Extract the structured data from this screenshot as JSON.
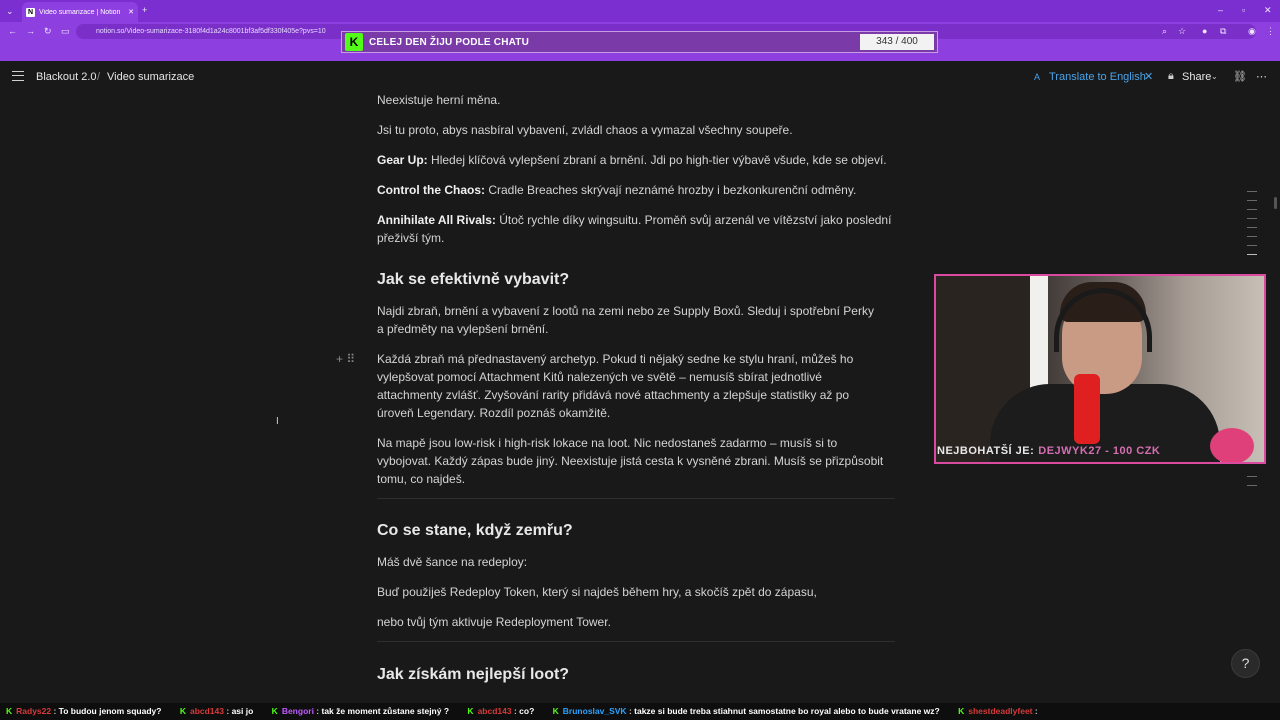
{
  "browser": {
    "tab_title": "Video sumarizace | Notion",
    "url": "notion.so/Video-sumarizace-3180f4d1a24c8001bf3af5df330f405e?pvs=10"
  },
  "goal_overlay": {
    "text": "CELEJ DEN ŽIJU PODLE CHATU",
    "count": "343 / 400"
  },
  "notion": {
    "breadcrumb": [
      "Blackout 2.0",
      "Video sumarizace"
    ],
    "translate_label": "Translate to English",
    "share_label": "Share"
  },
  "content": {
    "p1": "Neexistuje herní měna.",
    "p2": "Jsi tu proto, abys nasbíral vybavení, zvládl chaos a vymazal všechny soupeře.",
    "p3_bold": "Gear Up:",
    "p3": " Hledej klíčová vylepšení zbraní a brnění. Jdi po high-tier výbavě všude, kde se objeví.",
    "p4_bold": "Control the Chaos:",
    "p4": " Cradle Breaches skrývají neznámé hrozby i bezkonkurenční odměny.",
    "p5_bold": "Annihilate All Rivals:",
    "p5": " Útoč rychle díky wingsuitu. Proměň svůj arzenál ve vítězství jako poslední přeživší tým.",
    "h1": "Jak se efektivně vybavit?",
    "p6": "Najdi zbraň, brnění a vybavení z lootů na zemi nebo ze Supply Boxů. Sleduj i spotřební Perky a předměty na vylepšení brnění.",
    "p7": "Každá zbraň má přednastavený archetyp. Pokud ti nějaký sedne ke stylu hraní, můžeš ho vylepšovat pomocí Attachment Kitů nalezených ve světě – nemusíš sbírat jednotlivé attachmenty zvlášť. Zvyšování rarity přidává nové attachmenty a zlepšuje statistiky až po úroveň Legendary. Rozdíl poznáš okamžitě.",
    "p8": "Na mapě jsou low-risk i high-risk lokace na loot. Nic nedostaneš zadarmo – musíš si to vybojovat. Každý zápas bude jiný. Neexistuje jistá cesta k vysněné zbrani. Musíš se přizpůsobit tomu, co najdeš.",
    "h2": "Co se stane, když zemřu?",
    "p9": "Máš dvě šance na redeploy:",
    "p10": "Buď použiješ Redeploy Token, který si najdeš během hry, a skočíš zpět do zápasu,",
    "p11": "nebo tvůj tým aktivuje Redeployment Tower.",
    "h3": "Jak získám nejlepší loot?"
  },
  "stream": {
    "donor_label": "NEJBOHATŠÍ JE:",
    "donor_value": "DEJWYK27 - 100 CZK"
  },
  "chat": [
    {
      "user": "Radys22",
      "text": "To budou jenom squady?"
    },
    {
      "user": "abcd143",
      "text": "asi jo"
    },
    {
      "user": "Bengori",
      "text": "tak že moment zůstane stejný ?"
    },
    {
      "user": "abcd143",
      "text": "co?"
    },
    {
      "user": "Brunoslav_SVK",
      "text": "takze si bude treba stiahnut samostatne bo royal alebo to bude vratane wz?"
    },
    {
      "user": "shestdeadlyfeet",
      "text": ""
    }
  ],
  "colors": {
    "kick_green": "#53fc18",
    "browser_purple": "#8e3fe0",
    "link_blue": "#4aa3e8"
  }
}
